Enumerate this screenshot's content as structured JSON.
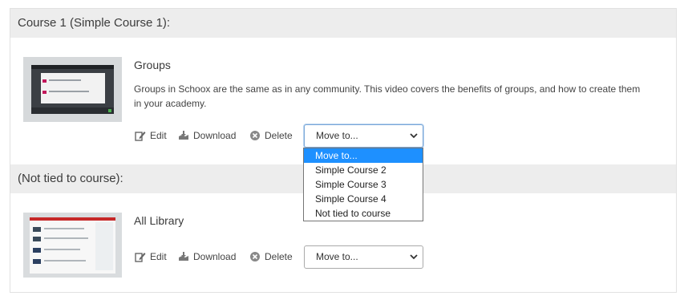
{
  "sections": [
    {
      "header": "Course 1 (Simple Course 1):",
      "item": {
        "title": "Groups",
        "description": "Groups in Schoox are the same as in any community. This video covers the benefits of groups, and how to create them in your academy.",
        "actions": {
          "edit": "Edit",
          "download": "Download",
          "delete": "Delete"
        },
        "move_select": {
          "value": "Move to...",
          "expanded": true,
          "options": [
            "Move to...",
            "Simple Course 2",
            "Simple Course 3",
            "Simple Course 4",
            "Not tied to course"
          ],
          "highlighted_index": 0
        }
      }
    },
    {
      "header": "(Not tied to course):",
      "item": {
        "title": "All Library",
        "actions": {
          "edit": "Edit",
          "download": "Download",
          "delete": "Delete"
        },
        "move_select": {
          "value": "Move to...",
          "expanded": false
        }
      }
    }
  ],
  "colors": {
    "header_bg": "#ededed",
    "highlight": "#1e90ff",
    "border": "#e1e1e1"
  },
  "icons": [
    "edit-icon",
    "download-icon",
    "delete-icon",
    "chevron-down-icon"
  ]
}
